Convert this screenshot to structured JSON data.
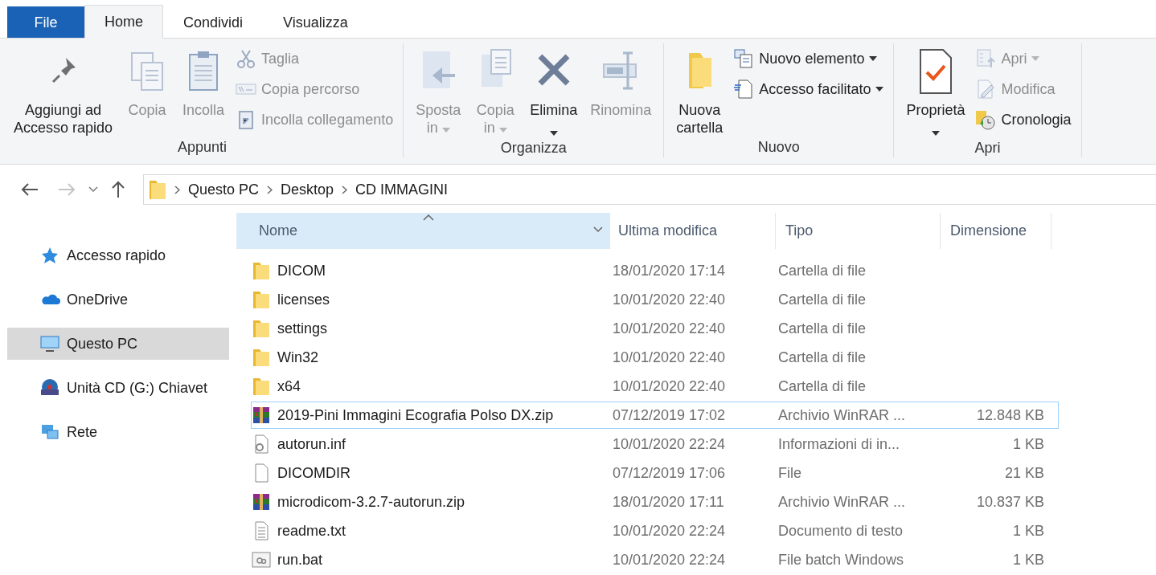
{
  "tabs": [
    {
      "label": "File",
      "kind": "file",
      "selected": false
    },
    {
      "label": "Home",
      "kind": "tab",
      "selected": true
    },
    {
      "label": "Condividi",
      "kind": "tab",
      "selected": false
    },
    {
      "label": "Visualizza",
      "kind": "tab",
      "selected": false
    }
  ],
  "ribbon": {
    "groups": [
      {
        "label": "Appunti",
        "items": [
          {
            "label": "Aggiungi ad\nAccesso rapido",
            "large": true,
            "kind": "pin",
            "disabled": false,
            "dropdown": false
          },
          {
            "label": "Copia",
            "large": true,
            "kind": "copy",
            "disabled": true,
            "dropdown": false
          },
          {
            "label": "Incolla",
            "large": true,
            "kind": "paste",
            "disabled": true,
            "dropdown": false
          },
          {
            "label": "Taglia",
            "large": false,
            "kind": "cut",
            "disabled": true,
            "dropdown": false
          },
          {
            "label": "Copia percorso",
            "large": false,
            "kind": "path",
            "disabled": true,
            "dropdown": false
          },
          {
            "label": "Incolla collegamento",
            "large": false,
            "kind": "shortcut",
            "disabled": true,
            "dropdown": false
          }
        ]
      },
      {
        "label": "Organizza",
        "items": [
          {
            "label": "Sposta\nin",
            "large": true,
            "kind": "move",
            "disabled": true,
            "dropdown": true
          },
          {
            "label": "Copia\nin",
            "large": true,
            "kind": "copyto",
            "disabled": true,
            "dropdown": true
          },
          {
            "label": "Elimina",
            "large": true,
            "kind": "delete",
            "disabled": false,
            "dropdown": true
          },
          {
            "label": "Rinomina",
            "large": true,
            "kind": "rename",
            "disabled": true,
            "dropdown": false
          }
        ]
      },
      {
        "label": "Nuovo",
        "items": [
          {
            "label": "Nuova\ncartella",
            "large": true,
            "kind": "folder",
            "disabled": false,
            "dropdown": false
          },
          {
            "label": "Nuovo elemento",
            "large": false,
            "kind": "newitem",
            "disabled": false,
            "dropdown": true
          },
          {
            "label": "Accesso facilitato",
            "large": false,
            "kind": "easy",
            "disabled": false,
            "dropdown": true
          }
        ]
      },
      {
        "label": "Apri",
        "items": [
          {
            "label": "Proprietà",
            "large": true,
            "kind": "props",
            "disabled": false,
            "dropdown": true
          },
          {
            "label": "Apri",
            "large": false,
            "kind": "open",
            "disabled": true,
            "dropdown": true
          },
          {
            "label": "Modifica",
            "large": false,
            "kind": "edit",
            "disabled": true,
            "dropdown": false
          },
          {
            "label": "Cronologia",
            "large": false,
            "kind": "history",
            "disabled": false,
            "dropdown": false
          }
        ]
      }
    ]
  },
  "nav": {
    "back_disabled": false,
    "forward_disabled": true,
    "breadcrumb": [
      "Questo PC",
      "Desktop",
      "CD IMMAGINI"
    ]
  },
  "sidebar": {
    "items": [
      {
        "label": "Accesso rapido",
        "kind": "star",
        "selected": false
      },
      {
        "label": "OneDrive",
        "kind": "cloud",
        "selected": false
      },
      {
        "label": "Questo PC",
        "kind": "pc",
        "selected": true
      },
      {
        "label": "Unità CD (G:) Chiavet",
        "kind": "cd",
        "selected": false
      },
      {
        "label": "Rete",
        "kind": "network",
        "selected": false
      }
    ]
  },
  "table": {
    "columns": [
      {
        "label": "Nome",
        "selected": true,
        "sorted": true
      },
      {
        "label": "Ultima modifica",
        "selected": false,
        "sorted": false
      },
      {
        "label": "Tipo",
        "selected": false,
        "sorted": false
      },
      {
        "label": "Dimensione",
        "selected": false,
        "sorted": false
      }
    ],
    "rows": [
      {
        "name": "DICOM",
        "modified": "18/01/2020 17:14",
        "type": "Cartella di file",
        "kind": "folder",
        "focused": false
      },
      {
        "name": "licenses",
        "modified": "10/01/2020 22:40",
        "type": "Cartella di file",
        "kind": "folder",
        "focused": false
      },
      {
        "name": "settings",
        "modified": "10/01/2020 22:40",
        "type": "Cartella di file",
        "kind": "folder",
        "focused": false
      },
      {
        "name": "Win32",
        "modified": "10/01/2020 22:40",
        "type": "Cartella di file",
        "kind": "folder",
        "focused": false
      },
      {
        "name": "x64",
        "modified": "10/01/2020 22:40",
        "type": "Cartella di file",
        "kind": "folder",
        "focused": false
      },
      {
        "name": "2019-Pini Immagini Ecografia Polso DX.zip",
        "modified": "07/12/2019 17:02",
        "type": "Archivio WinRAR ...",
        "size": "12.848 KB",
        "kind": "archive",
        "focused": true
      },
      {
        "name": "autorun.inf",
        "modified": "10/01/2020 22:24",
        "type": "Informazioni di in...",
        "size": "1 KB",
        "kind": "settings",
        "focused": false
      },
      {
        "name": "DICOMDIR",
        "modified": "07/12/2019 17:06",
        "type": "File",
        "size": "21 KB",
        "kind": "file",
        "focused": false
      },
      {
        "name": "microdicom-3.2.7-autorun.zip",
        "modified": "18/01/2020 17:11",
        "type": "Archivio WinRAR ...",
        "size": "10.837 KB",
        "kind": "archive",
        "focused": false
      },
      {
        "name": "readme.txt",
        "modified": "10/01/2020 22:24",
        "type": "Documento di testo",
        "size": "1 KB",
        "kind": "text",
        "focused": false
      },
      {
        "name": "run.bat",
        "modified": "10/01/2020 22:24",
        "type": "File batch Windows",
        "size": "1 KB",
        "kind": "batch",
        "focused": false
      }
    ]
  }
}
